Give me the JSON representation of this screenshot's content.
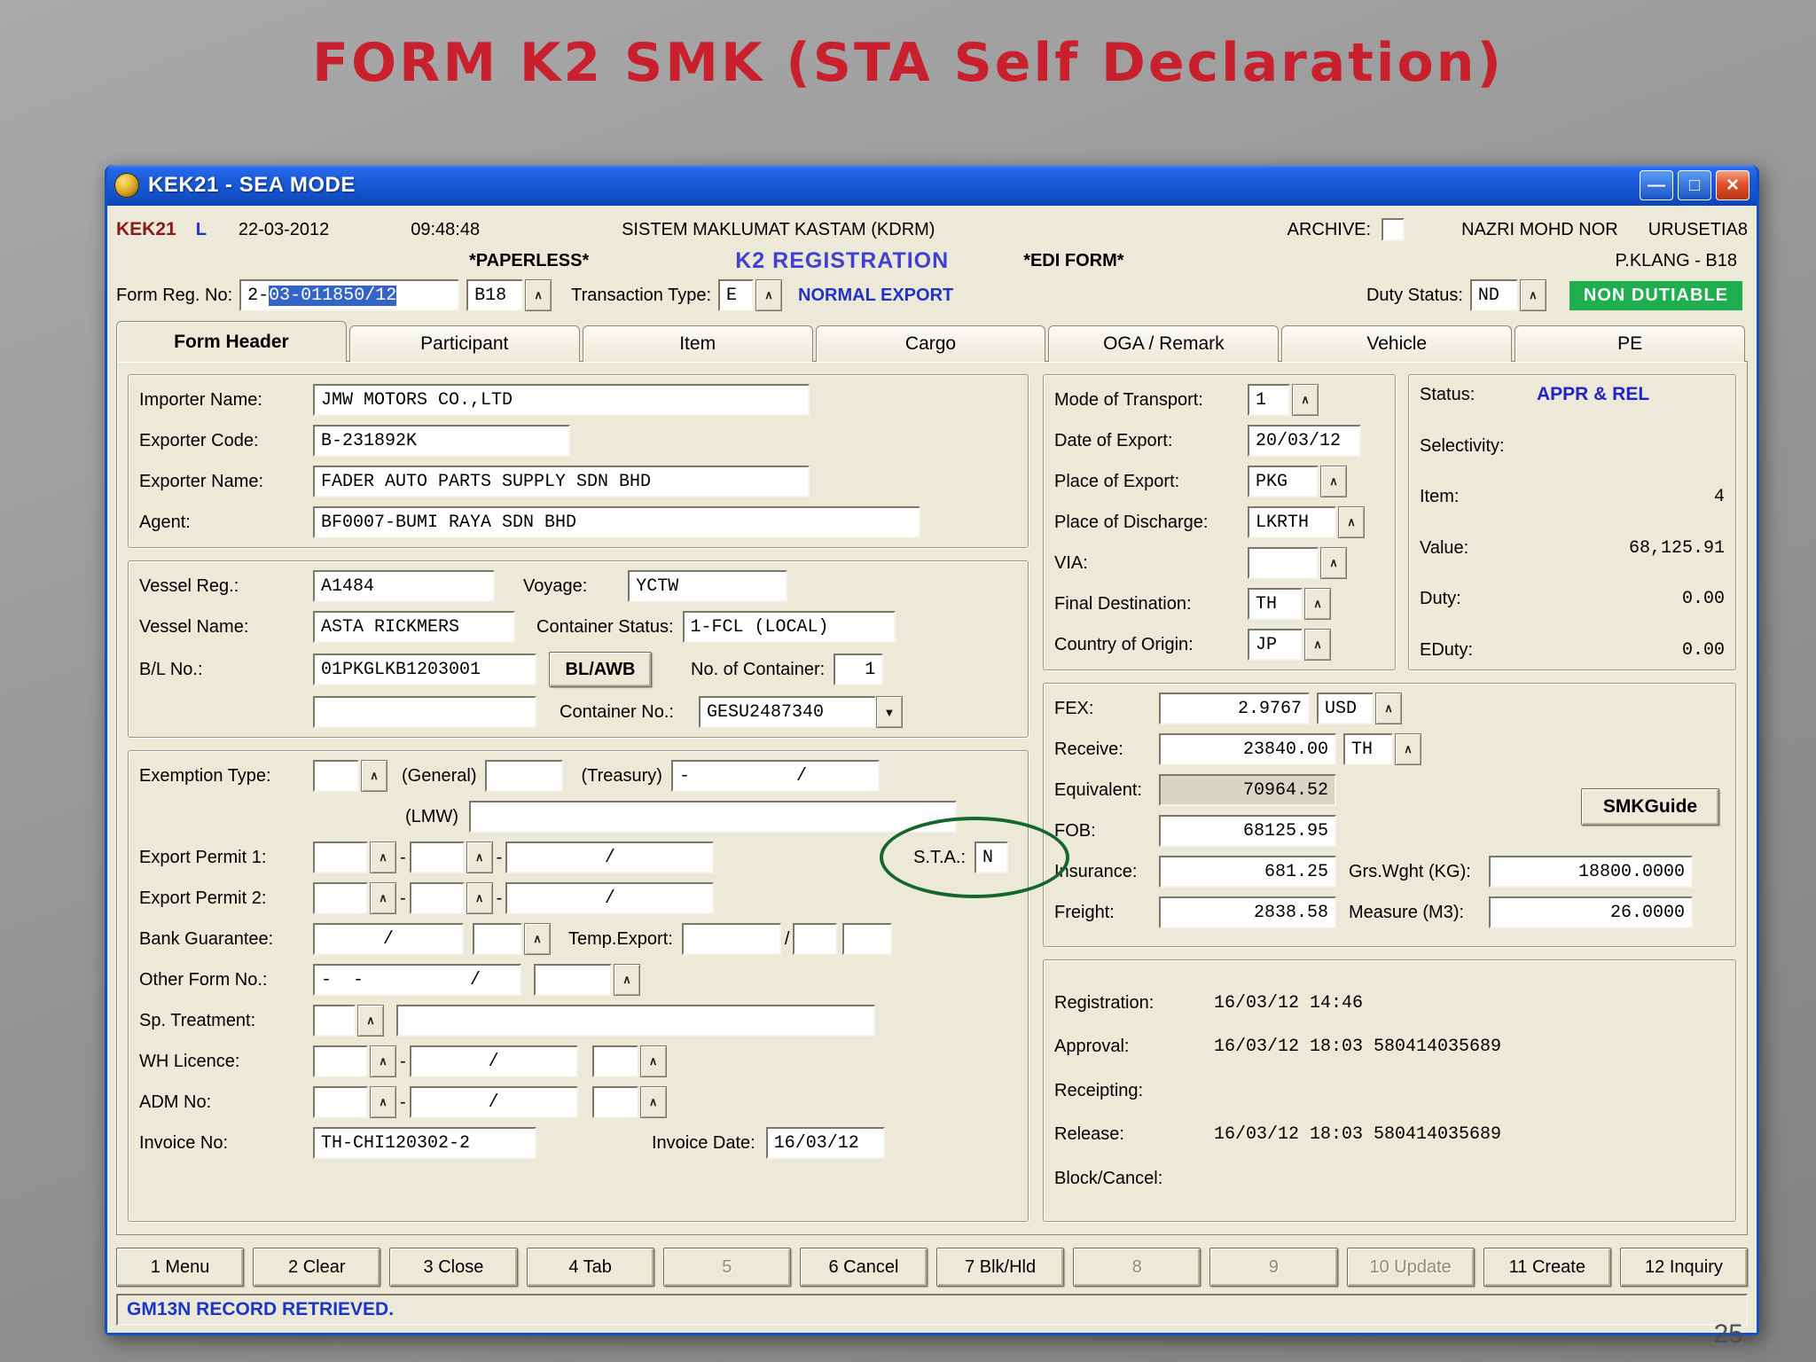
{
  "slide": {
    "title": "FORM K2 SMK (STA Self Declaration)",
    "page_number": "25"
  },
  "icons": {
    "minimize": "—",
    "maximize": "□",
    "close": "×",
    "caret": "∧",
    "dropdown": "▼"
  },
  "colors": {
    "title_red": "#c9202e",
    "xp_blue": "#1050c8",
    "badge_green": "#1fae4e",
    "status_blue": "#2222cc",
    "selection_blue": "#3464c8"
  },
  "symbols": {
    "dash": "-",
    "slash": "/"
  },
  "titlebar": {
    "title": "KEK21 - SEA MODE"
  },
  "header": {
    "app_code": "KEK21",
    "mode": "L",
    "date": "22-03-2012",
    "time": "09:48:48",
    "system": "SISTEM MAKLUMAT KASTAM (KDRM)",
    "archive_label": "ARCHIVE:",
    "user": "NAZRI MOHD NOR",
    "role": "URUSETIA8",
    "paperless": "*PAPERLESS*",
    "reg_title": "K2 REGISTRATION",
    "edi": "*EDI FORM*",
    "station": "P.KLANG  -  B18"
  },
  "regline": {
    "form_reg_label": "Form Reg. No:",
    "form_reg_prefix": "2-",
    "form_reg_selected": "03-011850/12",
    "branch_code": "B18",
    "txn_label": "Transaction Type:",
    "txn_value": "E",
    "txn_desc": "NORMAL EXPORT",
    "duty_label": "Duty Status:",
    "duty_value": "ND",
    "duty_badge": "NON DUTIABLE"
  },
  "tabs": [
    "Form Header",
    "Participant",
    "Item",
    "Cargo",
    "OGA / Remark",
    "Vehicle",
    "PE"
  ],
  "main": {
    "parties": {
      "importer": {
        "label": "Importer Name:",
        "value": "JMW MOTORS CO.,LTD"
      },
      "exporter_code": {
        "label": "Exporter Code:",
        "value": "B-231892K"
      },
      "exporter_name": {
        "label": "Exporter Name:",
        "value": "FADER AUTO PARTS SUPPLY SDN BHD"
      },
      "agent": {
        "label": "Agent:",
        "value": "BF0007-BUMI RAYA SDN BHD"
      }
    },
    "shipment": {
      "vessel_reg": {
        "label": "Vessel Reg.:",
        "value": "A1484"
      },
      "voyage": {
        "label": "Voyage:",
        "value": "YCTW"
      },
      "vessel_name": {
        "label": "Vessel Name:",
        "value": "ASTA RICKMERS"
      },
      "container_status": {
        "label": "Container Status:",
        "value": "1-FCL (LOCAL)"
      },
      "bl_no": {
        "label": "B/L No.:",
        "value": "01PKGLKB1203001"
      },
      "bl_awb_button": "BL/AWB",
      "no_of_container": {
        "label": "No. of Container:",
        "value": "1"
      },
      "bl_no2": "",
      "container_no": {
        "label": "Container No.:",
        "value": "GESU2487340"
      }
    },
    "exemption": {
      "type_label": "Exemption Type:",
      "type_value": "",
      "general_label": "(General)",
      "general_value": "",
      "treasury_label": "(Treasury)",
      "treasury_value": "-          /",
      "lmw_label": "(LMW)",
      "lmw_value": "",
      "permit1_label": "Export Permit 1:",
      "permit2_label": "Export Permit 2:",
      "sta_label": "S.T.A.:",
      "sta_value": "N",
      "bank_label": "Bank Guarantee:",
      "temp_label": "Temp.Export:",
      "other_label": "Other Form No.:",
      "other_value": "-  -          /",
      "sp_label": "Sp. Treatment:",
      "wh_label": "WH Licence:",
      "adm_label": "ADM No:",
      "invoice_no": {
        "label": "Invoice No:",
        "value": "TH-CHI120302-2"
      },
      "invoice_date": {
        "label": "Invoice Date:",
        "value": "16/03/12"
      }
    },
    "transport": {
      "mode": {
        "label": "Mode of Transport:",
        "value": "1"
      },
      "date_export": {
        "label": "Date of Export:",
        "value": "20/03/12"
      },
      "place_export": {
        "label": "Place of Export:",
        "value": "PKG"
      },
      "place_discharge": {
        "label": "Place of Discharge:",
        "value": "LKRTH"
      },
      "via": {
        "label": "VIA:",
        "value": ""
      },
      "final_dest": {
        "label": "Final Destination:",
        "value": "TH"
      },
      "origin": {
        "label": "Country of Origin:",
        "value": "JP"
      }
    },
    "status_panel": {
      "status": {
        "label": "Status:",
        "value": "APPR & REL"
      },
      "selectivity": {
        "label": "Selectivity:",
        "value": ""
      },
      "item": {
        "label": "Item:",
        "value": "4"
      },
      "value": {
        "label": "Value:",
        "value": "68,125.91"
      },
      "duty": {
        "label": "Duty:",
        "value": "0.00"
      },
      "eduty": {
        "label": "EDuty:",
        "value": "0.00"
      }
    },
    "financial": {
      "fex": {
        "label": "FEX:",
        "value": "2.9767",
        "currency": "USD"
      },
      "receive": {
        "label": "Receive:",
        "value": "23840.00",
        "currency": "TH"
      },
      "equivalent": {
        "label": "Equivalent:",
        "value": "70964.52"
      },
      "fob": {
        "label": "FOB:",
        "value": "68125.95"
      },
      "insurance": {
        "label": "Insurance:",
        "value": "681.25"
      },
      "grs_wght": {
        "label": "Grs.Wght (KG):",
        "value": "18800.0000"
      },
      "freight": {
        "label": "Freight:",
        "value": "2838.58"
      },
      "measure": {
        "label": "Measure (M3):",
        "value": "26.0000"
      },
      "smkguide": "SMKGuide"
    },
    "dates": {
      "registration": {
        "label": "Registration:",
        "value": "16/03/12 14:46"
      },
      "approval": {
        "label": "Approval:",
        "value": "16/03/12 18:03 580414035689"
      },
      "receipting": {
        "label": "Receipting:",
        "value": ""
      },
      "release": {
        "label": "Release:",
        "value": "16/03/12 18:03 580414035689"
      },
      "block_cancel": {
        "label": "Block/Cancel:",
        "value": ""
      }
    }
  },
  "fkeys": [
    {
      "label": "1 Menu",
      "enabled": true
    },
    {
      "label": "2 Clear",
      "enabled": true
    },
    {
      "label": "3 Close",
      "enabled": true
    },
    {
      "label": "4 Tab",
      "enabled": true
    },
    {
      "label": "5",
      "enabled": false
    },
    {
      "label": "6 Cancel",
      "enabled": true
    },
    {
      "label": "7 Blk/Hld",
      "enabled": true
    },
    {
      "label": "8",
      "enabled": false
    },
    {
      "label": "9",
      "enabled": false
    },
    {
      "label": "10 Update",
      "enabled": false
    },
    {
      "label": "11 Create",
      "enabled": true
    },
    {
      "label": "12 Inquiry",
      "enabled": true
    }
  ],
  "statusbar": {
    "message": "GM13N  RECORD RETRIEVED."
  }
}
